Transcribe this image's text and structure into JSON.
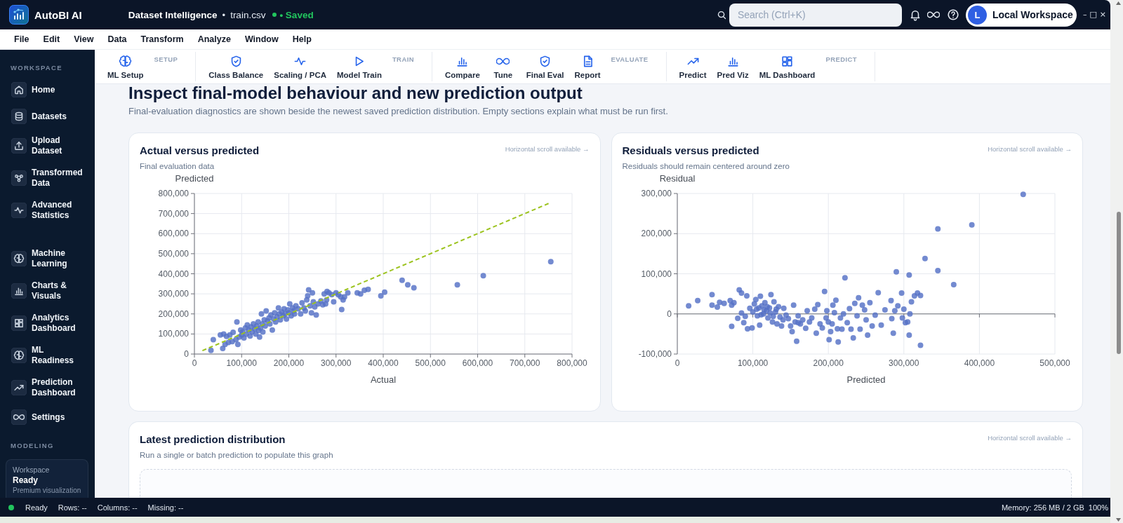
{
  "top_bar": {
    "app_name": "AutoBI AI",
    "context": "Dataset Intelligence",
    "separator": "•",
    "file": "train.csv",
    "save_status": "• Saved",
    "search": {
      "placeholder": "Search (Ctrl+K)"
    },
    "user": {
      "initial": "L",
      "name": "Local Workspace"
    },
    "window_controls": [
      "–",
      "□",
      "×"
    ]
  },
  "menu": [
    "File",
    "Edit",
    "View",
    "Data",
    "Transform",
    "Analyze",
    "Window",
    "Help"
  ],
  "toolbar": {
    "groups": [
      {
        "label": "SETUP",
        "buttons": [
          "ML Setup"
        ]
      },
      {
        "label": "TRAIN",
        "buttons": [
          "Class Balance",
          "Scaling / PCA",
          "Model Train"
        ]
      },
      {
        "label": "EVALUATE",
        "buttons": [
          "Compare",
          "Tune",
          "Final Eval",
          "Report"
        ]
      },
      {
        "label": "PREDICT",
        "buttons": [
          "Predict",
          "Pred Viz",
          "ML Dashboard"
        ]
      }
    ]
  },
  "sidebar": {
    "heading": "WORKSPACE",
    "groups": [
      {
        "items": [
          {
            "label": "Home",
            "selected": false
          },
          {
            "label": "Datasets",
            "selected": false
          },
          {
            "label": "Upload Dataset",
            "selected": false
          },
          {
            "label": "Transformed Data",
            "selected": false
          },
          {
            "label": "Advanced Statistics",
            "selected": false
          }
        ]
      },
      {
        "items": [
          {
            "label": "Machine Learning",
            "selected": false
          },
          {
            "label": "Charts & Visuals",
            "selected": false
          },
          {
            "label": "Analytics Dashboard",
            "selected": false
          },
          {
            "label": "ML Readiness",
            "selected": false
          },
          {
            "label": "Prediction Dashboard",
            "selected": false
          },
          {
            "label": "Settings",
            "selected": false
          }
        ]
      }
    ],
    "section": "MODELING",
    "workspace_card": {
      "label": "Workspace",
      "status": "Ready",
      "note": "Premium visualization"
    }
  },
  "page": {
    "title": "Inspect final-model behaviour and new prediction output",
    "description": "Final-evaluation diagnostics are shown beside the newest saved prediction distribution. Empty sections explain what must be run first."
  },
  "cards": [
    {
      "kind": "chart",
      "title": "Actual versus predicted",
      "subtitle": "Final evaluation data",
      "hint": "Horizontal scroll available →",
      "chart_data": {
        "type": "scatter",
        "xlabel": "Actual",
        "ylabel": "Predicted",
        "grid": true,
        "xlim": [
          0,
          800000
        ],
        "ylim": [
          0,
          800000
        ],
        "xticks": [
          {
            "value": 0,
            "label": "0"
          },
          {
            "value": 100000,
            "label": "100,000"
          },
          {
            "value": 200000,
            "label": "200,000"
          },
          {
            "value": 300000,
            "label": "300,000"
          },
          {
            "value": 400000,
            "label": "400,000"
          },
          {
            "value": 500000,
            "label": "500,000"
          },
          {
            "value": 600000,
            "label": "600,000"
          },
          {
            "value": 700000,
            "label": "700,000"
          },
          {
            "value": 800000,
            "label": "800,000"
          }
        ],
        "yticks": [
          {
            "value": 0,
            "label": "0"
          },
          {
            "value": 100000,
            "label": "100,000"
          },
          {
            "value": 200000,
            "label": "200,000"
          },
          {
            "value": 300000,
            "label": "300,000"
          },
          {
            "value": 400000,
            "label": "400,000"
          },
          {
            "value": 500000,
            "label": "500,000"
          },
          {
            "value": 600000,
            "label": "600,000"
          },
          {
            "value": 700000,
            "label": "700,000"
          },
          {
            "value": 800000,
            "label": "800,000"
          }
        ],
        "x": [
          35000,
          40000,
          55000,
          60000,
          62000,
          65000,
          68000,
          72000,
          75000,
          80000,
          82000,
          88000,
          90000,
          92000,
          95000,
          98000,
          100000,
          102000,
          105000,
          108000,
          110000,
          112000,
          115000,
          118000,
          120000,
          122000,
          125000,
          128000,
          130000,
          132000,
          135000,
          136000,
          138000,
          140000,
          142000,
          144000,
          145000,
          148000,
          150000,
          152000,
          155000,
          158000,
          160000,
          162000,
          165000,
          168000,
          170000,
          172000,
          175000,
          178000,
          180000,
          182000,
          185000,
          188000,
          190000,
          192000,
          195000,
          198000,
          200000,
          202000,
          205000,
          208000,
          210000,
          215000,
          220000,
          225000,
          228000,
          232000,
          235000,
          238000,
          240000,
          242000,
          245000,
          248000,
          250000,
          252000,
          255000,
          258000,
          262000,
          268000,
          272000,
          275000,
          278000,
          281000,
          285000,
          291000,
          295000,
          300000,
          305000,
          310000,
          312000,
          315000,
          318000,
          325000,
          345000,
          352000,
          360000,
          368000,
          395000,
          403000,
          440000,
          452000,
          465000,
          557000,
          612000,
          755000,
          212000,
          280000,
          17000
        ],
        "series": [
          {
            "color": "#5470c6",
            "values": [
              18000,
              72000,
              95000,
              28000,
              100000,
              48000,
              88000,
              58000,
              95000,
              62000,
              108000,
              72000,
              160000,
              48000,
              85000,
              120000,
              95000,
              110000,
              80000,
              130000,
              100000,
              145000,
              120000,
              90000,
              135000,
              110000,
              150000,
              125000,
              100000,
              140000,
              160000,
              118000,
              85000,
              130000,
              200000,
              150000,
              110000,
              170000,
              140000,
              215000,
              165000,
              180000,
              150000,
              195000,
              120000,
              175000,
              205000,
              160000,
              185000,
              230000,
              200000,
              170000,
              210000,
              190000,
              225000,
              200000,
              175000,
              220000,
              205000,
              250000,
              190000,
              230000,
              215000,
              240000,
              225000,
              200000,
              255000,
              230000,
              215000,
              270000,
              290000,
              320000,
              240000,
              205000,
              305000,
              260000,
              235000,
              195000,
              250000,
              265000,
              245000,
              300000,
              250000,
              312000,
              305000,
              296000,
              260000,
              305000,
              295000,
              285000,
              222000,
              270000,
              285000,
              305000,
              305000,
              300000,
              318000,
              322000,
              290000,
              308000,
              368000,
              345000,
              330000,
              345000,
              390000,
              460000,
              200000,
              270000,
              null
            ]
          },
          {
            "type": "line",
            "color": "#9cc31f",
            "line_style": "dashed",
            "values": [
              35000,
              40000,
              55000,
              60000,
              62000,
              65000,
              68000,
              72000,
              75000,
              80000,
              82000,
              88000,
              90000,
              92000,
              95000,
              98000,
              100000,
              102000,
              105000,
              108000,
              110000,
              112000,
              115000,
              118000,
              120000,
              122000,
              125000,
              128000,
              130000,
              132000,
              135000,
              136000,
              138000,
              140000,
              142000,
              144000,
              145000,
              148000,
              150000,
              152000,
              155000,
              158000,
              160000,
              162000,
              165000,
              168000,
              170000,
              172000,
              175000,
              178000,
              180000,
              182000,
              185000,
              188000,
              190000,
              192000,
              195000,
              198000,
              200000,
              202000,
              205000,
              208000,
              210000,
              215000,
              220000,
              225000,
              228000,
              232000,
              235000,
              238000,
              240000,
              242000,
              245000,
              248000,
              250000,
              252000,
              255000,
              258000,
              262000,
              268000,
              272000,
              275000,
              278000,
              281000,
              285000,
              291000,
              295000,
              300000,
              305000,
              310000,
              312000,
              315000,
              318000,
              325000,
              345000,
              352000,
              360000,
              368000,
              395000,
              403000,
              440000,
              452000,
              465000,
              557000,
              612000,
              755000,
              212000,
              280000,
              17000
            ]
          }
        ]
      }
    },
    {
      "kind": "chart",
      "title": "Residuals versus predicted",
      "subtitle": "Residuals should remain centered around zero",
      "hint": "Horizontal scroll available →",
      "chart_data": {
        "type": "scatter",
        "xlabel": "Predicted",
        "ylabel": "Residual",
        "grid": true,
        "xlim": [
          0,
          500000
        ],
        "ylim": [
          -100000,
          300000
        ],
        "xticks": [
          {
            "value": 0,
            "label": "0"
          },
          {
            "value": 100000,
            "label": "100,000"
          },
          {
            "value": 200000,
            "label": "200,000"
          },
          {
            "value": 300000,
            "label": "300,000"
          },
          {
            "value": 400000,
            "label": "400,000"
          },
          {
            "value": 500000,
            "label": "500,000"
          }
        ],
        "yticks": [
          {
            "value": -100000,
            "label": "-100,000"
          },
          {
            "value": 0,
            "label": "0"
          },
          {
            "value": 100000,
            "label": "100,000"
          },
          {
            "value": 200000,
            "label": "200,000"
          },
          {
            "value": 300000,
            "label": "300,000"
          }
        ],
        "x": [
          15000,
          27000,
          46000,
          46000,
          53000,
          56000,
          62000,
          70000,
          72000,
          72000,
          75000,
          80000,
          82000,
          85000,
          85000,
          88000,
          90000,
          92000,
          93000,
          96000,
          99000,
          100000,
          102000,
          104000,
          106000,
          108000,
          109000,
          110000,
          112000,
          114000,
          116000,
          118000,
          120000,
          122000,
          124000,
          126000,
          128000,
          130000,
          132000,
          134000,
          136000,
          138000,
          141000,
          144000,
          147000,
          150000,
          152000,
          154000,
          156000,
          158000,
          160000,
          163000,
          166000,
          170000,
          172000,
          175000,
          178000,
          182000,
          184000,
          186000,
          189000,
          192000,
          195000,
          197000,
          200000,
          201000,
          203000,
          206000,
          208000,
          210000,
          212000,
          213000,
          216000,
          218000,
          220000,
          222000,
          225000,
          228000,
          230000,
          233000,
          235000,
          238000,
          240000,
          242000,
          245000,
          248000,
          250000,
          252000,
          255000,
          258000,
          262000,
          266000,
          270000,
          275000,
          283000,
          284000,
          286000,
          288000,
          290000,
          292000,
          297000,
          298000,
          300000,
          302000,
          305000,
          307000,
          307000,
          308000,
          310000,
          314000,
          318000,
          322000,
          322000,
          328000,
          345000,
          345000,
          366000,
          390000,
          458000,
          105000,
          111000,
          115000,
          119000,
          123000,
          127000,
          131000,
          140000,
          160000,
          198000,
          205000
        ],
        "series": [
          {
            "color": "#5470c6",
            "values": [
              20000,
              33000,
              48000,
              22000,
              17000,
              29000,
              26000,
              33000,
              -31000,
              22000,
              28000,
              -11000,
              60000,
              52000,
              2000,
              -22000,
              -6000,
              45000,
              -37000,
              14000,
              -35000,
              5000,
              25000,
              36000,
              -5000,
              15000,
              -28000,
              44000,
              20000,
              0,
              28000,
              8000,
              -10000,
              15000,
              48000,
              -20000,
              30000,
              5000,
              -25000,
              18000,
              -8000,
              -30000,
              14000,
              -3000,
              -12000,
              -30000,
              -44000,
              22000,
              -20000,
              -68000,
              -5000,
              -25000,
              -15000,
              -36000,
              8000,
              -20000,
              -10000,
              12000,
              -48000,
              23000,
              -25000,
              -35000,
              56000,
              -10000,
              -20000,
              -64000,
              -44000,
              22000,
              3000,
              34000,
              -37000,
              -70000,
              -10000,
              -38000,
              0,
              90000,
              -22000,
              13000,
              -38000,
              -60000,
              26000,
              -5000,
              40000,
              -38000,
              22000,
              10000,
              -15000,
              -53000,
              28000,
              -30000,
              -3000,
              53000,
              -28000,
              10000,
              33000,
              -12000,
              -48000,
              8000,
              105000,
              20000,
              52000,
              -10000,
              12000,
              -22000,
              -20000,
              97000,
              -53000,
              0,
              30000,
              45000,
              52000,
              -78000,
              46000,
              138000,
              108000,
              212000,
              73000,
              222000,
              298000,
              12000,
              -2000,
              10000,
              18000,
              2000,
              -6000,
              12000,
              -15000,
              -22000,
              8000,
              -25000
            ]
          }
        ]
      }
    },
    {
      "kind": "empty",
      "title": "Latest prediction distribution",
      "subtitle": "Run a single or batch prediction to populate this graph",
      "hint": "Horizontal scroll available →"
    }
  ],
  "status_bar": {
    "state": "Ready",
    "rows": "Rows: --",
    "columns": "Columns: --",
    "missing": "Missing: --",
    "memory": "Memory: 256 MB / 2 GB",
    "zoom": "100%"
  }
}
